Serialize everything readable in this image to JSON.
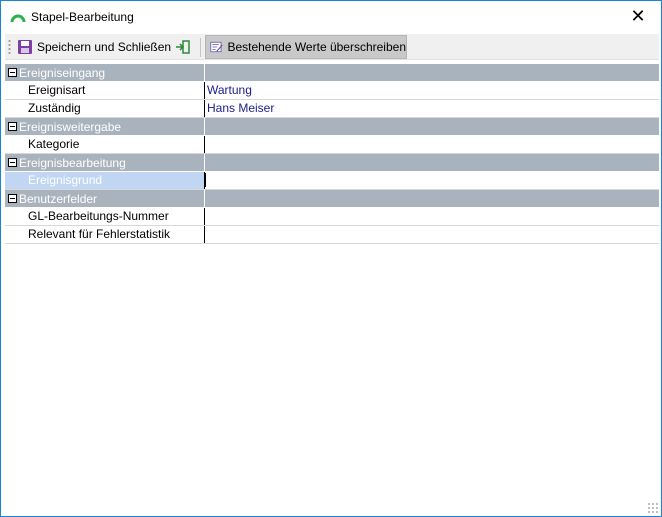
{
  "window": {
    "title": "Stapel-Bearbeitung",
    "close_label": "✕"
  },
  "toolbar": {
    "save_close_label": "Speichern und Schließen",
    "overwrite_label": "Bestehende Werte überschreiben"
  },
  "grid": {
    "categories": [
      {
        "label": "Ereigniseingang",
        "rows": [
          {
            "name": "Ereignisart",
            "value": "Wartung"
          },
          {
            "name": "Zuständig",
            "value": "Hans Meiser"
          }
        ]
      },
      {
        "label": "Ereignisweitergabe",
        "rows": [
          {
            "name": "Kategorie",
            "value": ""
          }
        ]
      },
      {
        "label": "Ereignisbearbeitung",
        "rows": [
          {
            "name": "Ereignisgrund",
            "value": "",
            "selected": true
          }
        ]
      },
      {
        "label": "Benutzerfelder",
        "rows": [
          {
            "name": "GL-Bearbeitungs-Nummer",
            "value": ""
          },
          {
            "name": "Relevant für Fehlerstatistik",
            "value": ""
          }
        ]
      }
    ]
  },
  "colors": {
    "category_bg": "#a9b3bd",
    "selected_bg": "#c0d6f2",
    "value_text": "#1c1c8c",
    "window_border": "#1883d7"
  }
}
